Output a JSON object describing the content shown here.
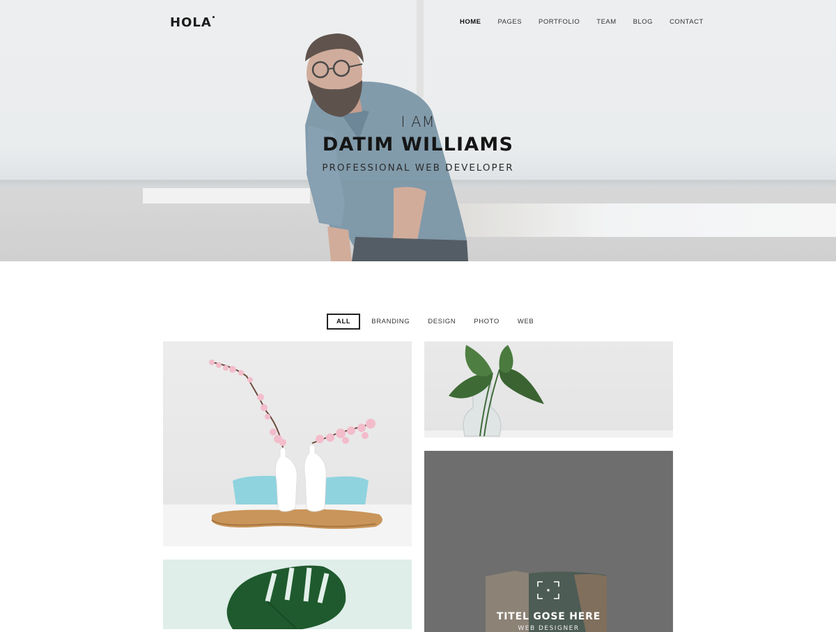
{
  "header": {
    "logo": "HOLA",
    "nav": [
      "HOME",
      "PAGES",
      "PORTFOLIO",
      "TEAM",
      "BLOG",
      "CONTACT"
    ],
    "active_nav": "HOME"
  },
  "hero": {
    "intro": "I AM",
    "name": "DATIM WILLIAMS",
    "role": "PROFESSIONAL WEB DEVELOPER"
  },
  "portfolio": {
    "filters": [
      "ALL",
      "BRANDING",
      "DESIGN",
      "PHOTO",
      "WEB"
    ],
    "active_filter": "ALL",
    "items": [
      {
        "image": "flowers-in-vases-photo"
      },
      {
        "image": "leaf-in-glass-vase-photo"
      },
      {
        "image": "book-mockup-photo",
        "title": "TITEL GOSE HERE",
        "subtitle": "WEB DESIGNER",
        "icon": "focus-icon"
      },
      {
        "image": "monstera-leaf-photo"
      }
    ]
  },
  "colors": {
    "text_dark": "#151515",
    "hover_overlay": "#6e6e6e"
  }
}
